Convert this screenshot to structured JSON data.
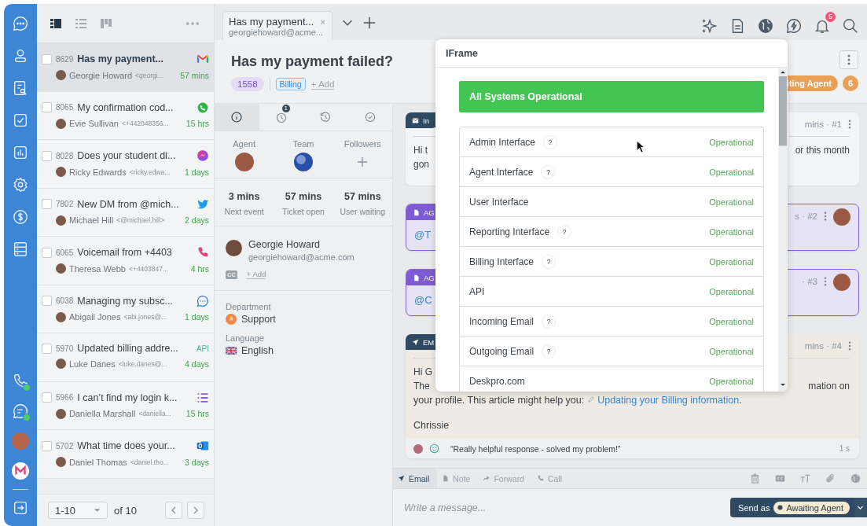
{
  "rail": {
    "phone_online": true,
    "chat_online": true
  },
  "list": {
    "views": [
      {
        "kind": "split",
        "selected": true
      },
      {
        "kind": "list",
        "selected": false
      },
      {
        "kind": "board",
        "selected": false
      }
    ],
    "tickets": [
      {
        "id": "8629",
        "subject": "Has my payment...",
        "name": "Georgie Howard",
        "contact": "<georgi...",
        "time": "57 mins",
        "kind": "gmail",
        "selected": true,
        "checked": false
      },
      {
        "id": "8065",
        "subject": "My confirmation cod...",
        "name": "Evie Sullivan",
        "contact": "<+442048356...",
        "time": "15 hrs",
        "kind": "whatsapp",
        "selected": false,
        "checked": false
      },
      {
        "id": "8028",
        "subject": "Does your student di...",
        "name": "Ricky Edwards",
        "contact": "<ricky.edwa...",
        "time": "1 days",
        "kind": "messenger",
        "selected": false,
        "checked": false
      },
      {
        "id": "7802",
        "subject": "New DM from @mich...",
        "name": "Michael Hill",
        "contact": "<@michael.hill>",
        "time": "2 days",
        "kind": "twitter",
        "selected": false,
        "checked": false
      },
      {
        "id": "6065",
        "subject": "Voicemail from +4403",
        "name": "Theresa Webb",
        "contact": "<+4403847...",
        "time": "4 hrs",
        "kind": "phone",
        "selected": false,
        "checked": false
      },
      {
        "id": "6038",
        "subject": "Managing my subsc...",
        "name": "Abigail Jones",
        "contact": "<abi.jones@...",
        "time": "1 days",
        "kind": "chat",
        "selected": false,
        "checked": false
      },
      {
        "id": "5970",
        "subject": "Updated billing addre...",
        "name": "Luke Danes",
        "contact": "<luke.danes@...",
        "time": "4 days",
        "kind": "api",
        "channel_text": "API",
        "selected": false,
        "checked": false
      },
      {
        "id": "5966",
        "subject": "I can’t find my login k...",
        "name": "Daniella Marshall",
        "contact": "<daniella...",
        "time": "15 hrs",
        "kind": "form",
        "selected": false,
        "checked": false
      },
      {
        "id": "5702",
        "subject": "What time does your...",
        "name": "Daniel Thomas",
        "contact": "<daniel.tho...",
        "time": "3 days",
        "kind": "outlook",
        "selected": false,
        "checked": false
      }
    ],
    "pagination": {
      "range": "1-10",
      "total": "of 10"
    }
  },
  "topbar": {
    "tab": {
      "title": "Has my payment...",
      "subtitle": "georgiehoward@acme...",
      "close": "×"
    },
    "actions": [
      {
        "kind": "sparkles",
        "selected": false
      },
      {
        "kind": "document",
        "selected": false
      },
      {
        "kind": "globe",
        "selected": true
      },
      {
        "kind": "lightning",
        "selected": false
      },
      {
        "kind": "bell",
        "selected": false,
        "badge": "5"
      },
      {
        "kind": "search",
        "selected": false
      }
    ]
  },
  "ticket": {
    "title": "Has my payment failed?",
    "number": "1558",
    "labels": [
      "Billing"
    ],
    "add": "+ Add",
    "status": "iting Agent",
    "count": "6"
  },
  "details": {
    "tabs": [
      {
        "kind": "info",
        "selected": true
      },
      {
        "kind": "timer",
        "selected": false,
        "badge": "1"
      },
      {
        "kind": "history",
        "selected": false
      },
      {
        "kind": "check",
        "selected": false
      }
    ],
    "people": [
      {
        "label": "Agent",
        "kind": "avatar"
      },
      {
        "label": "Team",
        "kind": "team"
      },
      {
        "label": "Followers",
        "kind": "add"
      }
    ],
    "stats": [
      {
        "value": "3 mins",
        "label": "Next event"
      },
      {
        "value": "57 mins",
        "label": "Ticket open"
      },
      {
        "value": "57 mins",
        "label": "User waiting"
      }
    ],
    "contact": {
      "name": "Georgie Howard",
      "email": "georgiehoward@acme.com",
      "cc": "CC",
      "add": "+ Add"
    },
    "fields": [
      {
        "label": "Department",
        "value": "Support",
        "kind": "department"
      },
      {
        "label": "Language",
        "value": "English",
        "kind": "flag"
      }
    ]
  },
  "messages": [
    {
      "kind": "incoming",
      "label": "In",
      "meta": "mins · #1",
      "avatar": false,
      "lines": [
        {
          "left": "Hi t",
          "right": "or this month"
        },
        {
          "left": "gon"
        }
      ]
    },
    {
      "kind": "note",
      "label": "AG",
      "meta": "s · #2",
      "avatar": true,
      "lines": [
        {
          "left": "@T"
        }
      ]
    },
    {
      "kind": "note",
      "label": "AG",
      "meta": "· #3",
      "avatar": true,
      "lines": [
        {
          "left": "@C"
        }
      ]
    },
    {
      "kind": "outgoing",
      "label": "EM",
      "meta": "mins · #4",
      "avatar": false,
      "lines": [
        {
          "left": "Hi G"
        },
        {
          "left": "The",
          "right": "mation on"
        }
      ],
      "text_before": "your profile. This article might help you:",
      "link": "Updating your Billing information",
      "text_after": ".",
      "signature": "Chrissie",
      "feedback": {
        "quote": "“Really helpful response - solved my problem!”",
        "time": "1 s"
      }
    }
  ],
  "composer": {
    "tabs": [
      {
        "label": "Email",
        "kind": "send",
        "selected": true
      },
      {
        "label": "Note",
        "kind": "note",
        "selected": false
      },
      {
        "label": "Forward",
        "kind": "forward",
        "selected": false
      },
      {
        "label": "Call",
        "kind": "phone",
        "selected": false
      }
    ],
    "placeholder": "Write a message...",
    "send_label": "Send as",
    "send_status": "Awaiting Agent"
  },
  "popup": {
    "title": "IFrame",
    "banner": "All Systems Operational",
    "rows": [
      {
        "name": "Admin Interface",
        "hint": "?",
        "status": "Operational"
      },
      {
        "name": "Agent Interface",
        "hint": "?",
        "status": "Operational"
      },
      {
        "name": "User Interface",
        "status": "Operational"
      },
      {
        "name": "Reporting Interface",
        "hint": "?",
        "status": "Operational"
      },
      {
        "name": "Billing Interface",
        "hint": "?",
        "status": "Operational"
      },
      {
        "name": "API",
        "status": "Operational"
      },
      {
        "name": "Incoming Email",
        "hint": "?",
        "status": "Operational"
      },
      {
        "name": "Outgoing Email",
        "hint": "?",
        "status": "Operational"
      },
      {
        "name": "Deskpro.com",
        "status": "Operational"
      }
    ]
  }
}
